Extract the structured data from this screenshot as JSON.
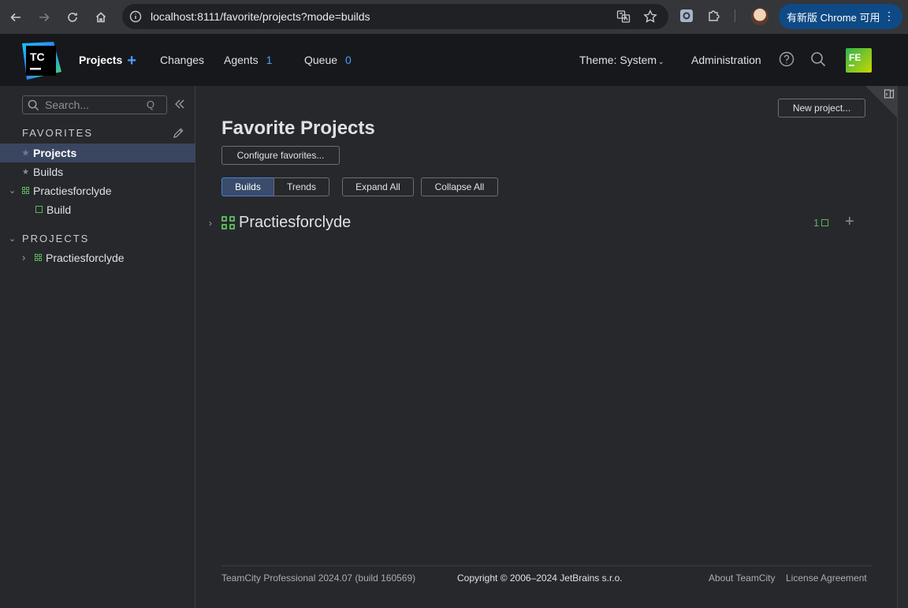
{
  "browser": {
    "url": "localhost:8111/favorite/projects?mode=builds",
    "update_label": "有新版 Chrome 可用"
  },
  "header": {
    "logo_text": "TC",
    "projects_label": "Projects",
    "changes_label": "Changes",
    "agents_label": "Agents",
    "agents_count": "1",
    "queue_label": "Queue",
    "queue_count": "0",
    "theme_label": "Theme: System",
    "administration_label": "Administration",
    "avatar_initials": "FE"
  },
  "sidebar": {
    "search_placeholder": "Search...",
    "search_shortcut": "Q",
    "favorites_title": "FAVORITES",
    "projects_title": "PROJECTS",
    "favorites": [
      {
        "label": "Projects"
      },
      {
        "label": "Builds"
      },
      {
        "label": "Practiesforclyde"
      },
      {
        "label": "Build"
      }
    ],
    "projects": [
      {
        "label": "Practiesforclyde"
      }
    ]
  },
  "main": {
    "title": "Favorite Projects",
    "new_project_label": "New project...",
    "configure_label": "Configure favorites...",
    "tabs": [
      {
        "label": "Builds"
      },
      {
        "label": "Trends"
      }
    ],
    "expand_label": "Expand All",
    "collapse_label": "Collapse All",
    "project_row": {
      "name": "Practiesforclyde",
      "count": "1"
    }
  },
  "footer": {
    "version": "TeamCity Professional 2024.07 (build 160569)",
    "copyright": "Copyright © 2006–2024 JetBrains s.r.o.",
    "about_label": "About TeamCity",
    "license_label": "License Agreement"
  },
  "colors": {
    "accent": "#4a9eff",
    "project_green": "#5ab65a",
    "selected_row": "#3a4560",
    "header_bg": "#17181b",
    "page_bg": "#27282c"
  }
}
